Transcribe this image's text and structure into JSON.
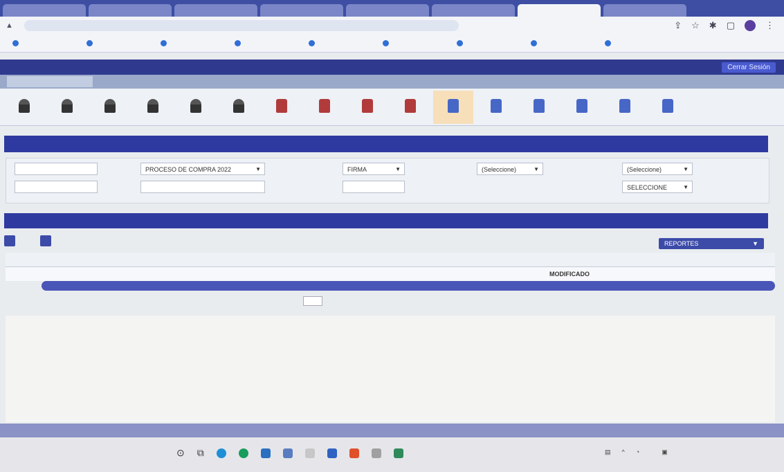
{
  "browser": {
    "tabs": [
      "",
      "",
      "",
      "",
      "",
      "",
      "",
      ""
    ],
    "url": ""
  },
  "bookmarks": [
    "",
    "",
    "",
    "",
    "",
    "",
    "",
    "",
    ""
  ],
  "app": {
    "title": "",
    "logout_label": "Cerrar Sesión"
  },
  "menu_tabs": [
    "",
    "",
    "",
    "",
    "",
    ""
  ],
  "toolbar": {
    "items": [
      {
        "label": "",
        "icon": "user-icon",
        "type": "user"
      },
      {
        "label": "",
        "icon": "user-icon",
        "type": "user"
      },
      {
        "label": "",
        "icon": "user-icon",
        "type": "user"
      },
      {
        "label": "",
        "icon": "user-icon",
        "type": "user"
      },
      {
        "label": "",
        "icon": "user-icon",
        "type": "user"
      },
      {
        "label": "",
        "icon": "user-icon",
        "type": "user"
      },
      {
        "label": "",
        "icon": "book-icon",
        "type": "book"
      },
      {
        "label": "",
        "icon": "book-icon",
        "type": "book"
      },
      {
        "label": "",
        "icon": "book-icon",
        "type": "book"
      },
      {
        "label": "",
        "icon": "book-icon",
        "type": "book"
      },
      {
        "label": "",
        "icon": "document-icon",
        "type": "doc",
        "active": true
      },
      {
        "label": "",
        "icon": "document-icon",
        "type": "doc"
      },
      {
        "label": "",
        "icon": "document-icon",
        "type": "doc"
      },
      {
        "label": "",
        "icon": "document-icon",
        "type": "doc"
      },
      {
        "label": "",
        "icon": "document-icon",
        "type": "doc"
      },
      {
        "label": "",
        "icon": "document-icon",
        "type": "doc"
      }
    ]
  },
  "filters": {
    "proceso": "PROCESO DE COMPRA 2022",
    "firma": "FIRMA",
    "select1": "(Seleccione)",
    "select2": "(Seleccione)",
    "seleccione_upper": "SELECCIONE"
  },
  "results": {
    "btn1": "",
    "btn2": "",
    "reports": "REPORTES",
    "headers": [
      "",
      "",
      "",
      "",
      "",
      "",
      "",
      "",
      "",
      "",
      "",
      ""
    ],
    "row": [
      "",
      "",
      "",
      "",
      "",
      "MODIFICADO",
      "",
      "",
      ""
    ]
  },
  "pager": {
    "label": "",
    "total": ""
  },
  "taskbar": {
    "search": "",
    "time": ""
  },
  "colors": {
    "primary": "#2f3aa0",
    "accent": "#f6dfb9"
  }
}
